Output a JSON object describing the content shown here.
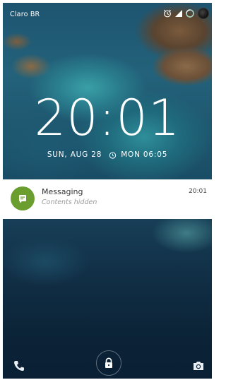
{
  "status_bar": {
    "carrier": "Claro BR",
    "icons": [
      "alarm-icon",
      "signal-icon",
      "battery-icon",
      "avatar"
    ]
  },
  "lock_screen": {
    "time": "20:01",
    "date": "SUN, AUG 28",
    "next_alarm": "MON 06:05"
  },
  "notification": {
    "app_icon": "messaging-icon",
    "app_name": "Messaging",
    "body": "Contents hidden",
    "time": "20:01",
    "accent_color": "#6a9e2e"
  },
  "bottom_bar": {
    "left": "phone-icon",
    "center": "lock-icon",
    "right": "camera-icon"
  }
}
